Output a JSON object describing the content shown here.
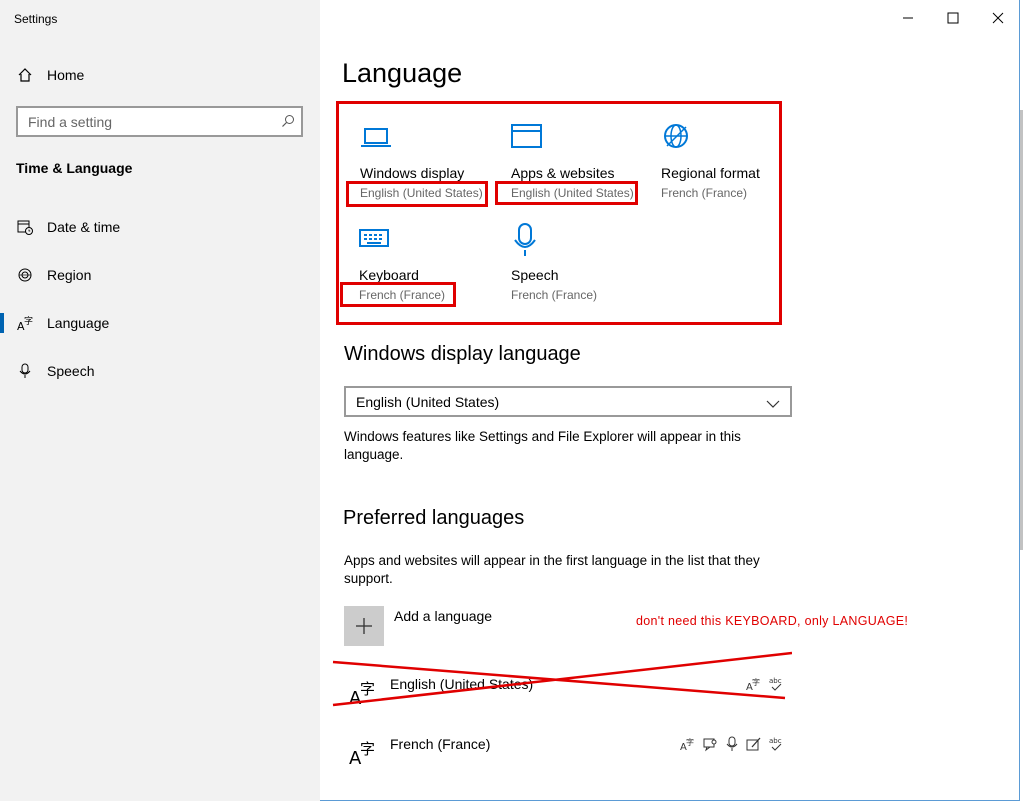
{
  "app": {
    "title": "Settings"
  },
  "window_controls": {
    "minimize": "—",
    "maximize": "☐",
    "close": "✕"
  },
  "sidebar": {
    "home_label": "Home",
    "search_placeholder": "Find a setting",
    "section_title": "Time & Language",
    "items": [
      {
        "label": "Date & time",
        "icon": "calendar-clock-icon"
      },
      {
        "label": "Region",
        "icon": "globe-icon"
      },
      {
        "label": "Language",
        "icon": "language-icon",
        "selected": true
      },
      {
        "label": "Speech",
        "icon": "microphone-icon"
      }
    ]
  },
  "main": {
    "title": "Language",
    "tiles": [
      {
        "label": "Windows display",
        "sub": "English (United States)",
        "icon": "laptop-icon"
      },
      {
        "label": "Apps & websites",
        "sub": "English (United States)",
        "icon": "window-icon"
      },
      {
        "label": "Regional format",
        "sub": "French (France)",
        "icon": "globe-icon"
      },
      {
        "label": "Keyboard",
        "sub": "French (France)",
        "icon": "keyboard-icon"
      },
      {
        "label": "Speech",
        "sub": "French (France)",
        "icon": "microphone-icon"
      }
    ],
    "display_language": {
      "heading": "Windows display language",
      "selected": "English (United States)",
      "description_line1": "Windows features like Settings and File Explorer will appear in this",
      "description_line2": "language."
    },
    "preferred": {
      "heading": "Preferred languages",
      "description_line1": "Apps and websites will appear in the first language in the list that they",
      "description_line2": "support.",
      "add_label": "Add a language",
      "languages": [
        {
          "name": "English (United States)",
          "features": [
            "display-language-icon",
            "spelling-icon"
          ]
        },
        {
          "name": "French (France)",
          "features": [
            "display-language-icon",
            "speech-icon",
            "microphone-icon",
            "handwriting-icon",
            "spelling-icon"
          ]
        }
      ]
    },
    "annotation_note": "don't need this KEYBOARD, only LANGUAGE!"
  },
  "colors": {
    "accent": "#0078d7",
    "annotation": "#e00000",
    "sidebar_bg": "#f2f2f2"
  }
}
